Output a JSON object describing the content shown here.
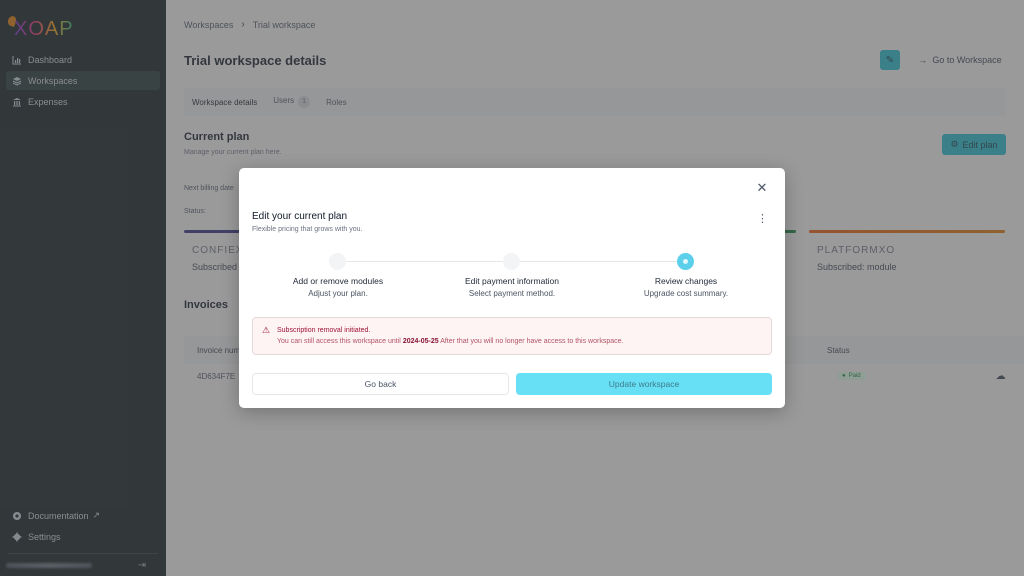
{
  "sidebar": {
    "logo": "XOAP",
    "items": [
      {
        "label": "Dashboard",
        "icon": "chart-icon",
        "active": false
      },
      {
        "label": "Workspaces",
        "icon": "layers-icon",
        "active": true
      },
      {
        "label": "Expenses",
        "icon": "bank-icon",
        "active": false
      }
    ],
    "bottom_items": [
      {
        "label": "Documentation",
        "icon": "help-icon",
        "external": true
      },
      {
        "label": "Settings",
        "icon": "gear-icon"
      }
    ],
    "external_glyph": "↗",
    "logout_glyph": "⇥"
  },
  "breadcrumb": {
    "items": [
      "Workspaces",
      "Trial workspace"
    ],
    "separator": "›"
  },
  "header": {
    "title": "Trial workspace details",
    "edit_glyph": "✎",
    "goto_label": "Go to Workspace",
    "goto_glyph": "→"
  },
  "tabs": [
    {
      "label": "Workspace details",
      "active": true
    },
    {
      "label": "Users",
      "badge": "1"
    },
    {
      "label": "Roles"
    }
  ],
  "current_plan": {
    "title": "Current plan",
    "subtitle": "Manage your current plan here.",
    "edit_label": "Edit plan",
    "edit_glyph": "⚙",
    "next_billing_label": "Next billing date",
    "status_label": "Status:",
    "cards": [
      {
        "name": "CONFIEX",
        "subscribed": "Subscribed",
        "color": "#312e81"
      },
      {
        "name": "PLATFORMXO",
        "subscribed": "Subscribed: module",
        "color": "#ea580c"
      }
    ],
    "green_accent": "#15803d"
  },
  "invoices": {
    "title": "Invoices",
    "columns": [
      "Invoice num",
      "Status"
    ],
    "rows": [
      {
        "number": "4D634F7E",
        "status": "Paid"
      }
    ],
    "download_glyph": "☁"
  },
  "modal": {
    "title": "Edit your current plan",
    "subtitle": "Flexible pricing that grows with you.",
    "close_glyph": "✕",
    "menu_glyph": "⋮",
    "steps": [
      {
        "label": "Add or remove modules",
        "desc": "Adjust your plan.",
        "active": false
      },
      {
        "label": "Edit payment information",
        "desc": "Select payment method.",
        "active": false
      },
      {
        "label": "Review changes",
        "desc": "Upgrade cost summary.",
        "active": true
      }
    ],
    "alert": {
      "glyph": "⚠",
      "title": "Subscription removal initiated.",
      "body_prefix": "You can still access this workspace until",
      "date": "2024-05-25",
      "body_suffix": "After that you will no longer have access to this workspace."
    },
    "back_label": "Go back",
    "update_label": "Update workspace",
    "accent_color": "#67dff5"
  }
}
